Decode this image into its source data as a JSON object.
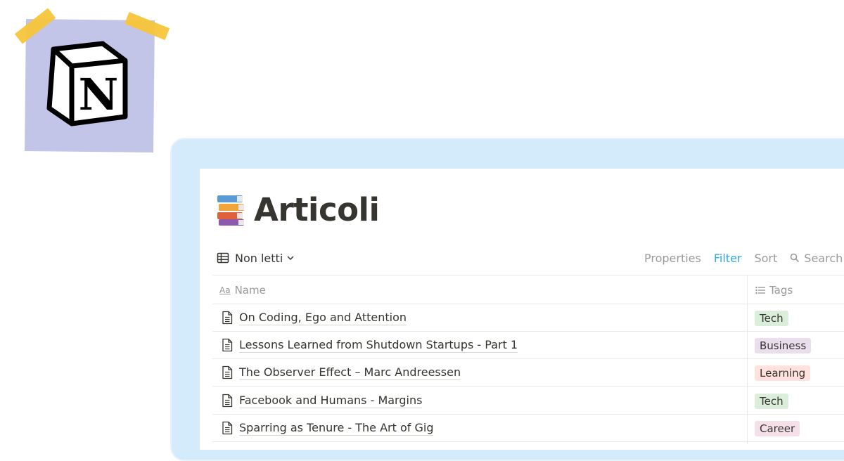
{
  "logo": {
    "name": "notion-logo",
    "letter": "N"
  },
  "colors": {
    "sticky": "#c3c5e8",
    "tape": "#f5c53a",
    "frame": "#d3ebfb",
    "text": "#37352f",
    "muted": "#9b9a97",
    "accent": "#2eaadc"
  },
  "page": {
    "title": "Articoli",
    "icon": "books-icon"
  },
  "view": {
    "label": "Non letti",
    "icon": "table-icon"
  },
  "toolbar": {
    "properties": "Properties",
    "filter": "Filter",
    "sort": "Sort",
    "search": "Search"
  },
  "columns": {
    "name": "Name",
    "tags": "Tags"
  },
  "rows": [
    {
      "name": "On Coding, Ego and Attention",
      "tag": "Tech",
      "tag_color": "#dbeddb"
    },
    {
      "name": "Lessons Learned from Shutdown Startups - Part 1",
      "tag": "Business",
      "tag_color": "#e8deee"
    },
    {
      "name": "The Observer Effect – Marc Andreessen",
      "tag": "Learning",
      "tag_color": "#ffe2dd"
    },
    {
      "name": "Facebook and Humans - Margins",
      "tag": "Tech",
      "tag_color": "#dbeddb"
    },
    {
      "name": "Sparring as Tenure - The Art of Gig",
      "tag": "Career",
      "tag_color": "#f5e0e9"
    }
  ]
}
